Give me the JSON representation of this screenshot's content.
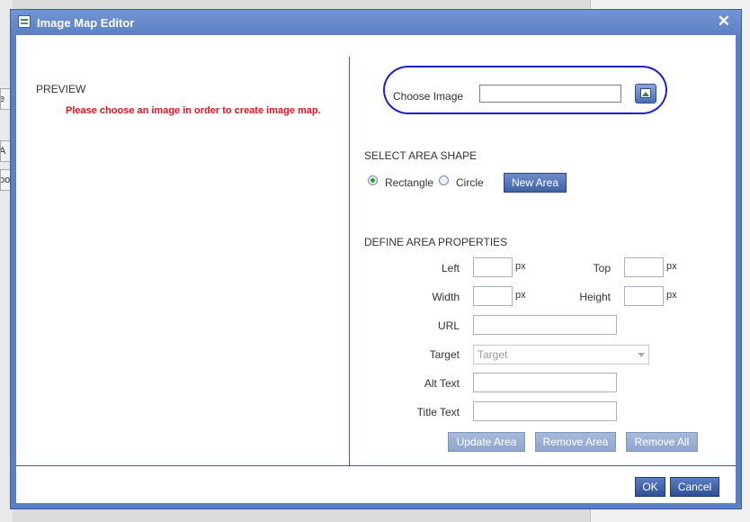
{
  "background": {
    "frag1": "e",
    "frag2": "A",
    "frag3": "oo"
  },
  "dialog": {
    "title": "Image Map Editor",
    "close_glyph": "✕"
  },
  "preview": {
    "label": "PREVIEW",
    "message": "Please choose an image in order to create image map."
  },
  "choose_image": {
    "label": "Choose Image",
    "value": ""
  },
  "area_shape": {
    "heading": "SELECT AREA SHAPE",
    "options": [
      "Rectangle",
      "Circle"
    ],
    "selected": "Rectangle",
    "new_area_label": "New Area"
  },
  "area_properties": {
    "heading": "DEFINE AREA PROPERTIES",
    "left_label": "Left",
    "top_label": "Top",
    "width_label": "Width",
    "height_label": "Height",
    "unit": "px",
    "url_label": "URL",
    "target_label": "Target",
    "target_placeholder": "Target",
    "alt_text_label": "Alt Text",
    "title_text_label": "Title Text"
  },
  "area_actions": {
    "update_label": "Update Area",
    "remove_label": "Remove Area",
    "remove_all_label": "Remove All"
  },
  "footer": {
    "ok_label": "OK",
    "cancel_label": "Cancel"
  },
  "colors": {
    "titlebar": "#5d80c3",
    "warning_text": "#e0141e",
    "annotation_outline": "#1d1fd0"
  }
}
